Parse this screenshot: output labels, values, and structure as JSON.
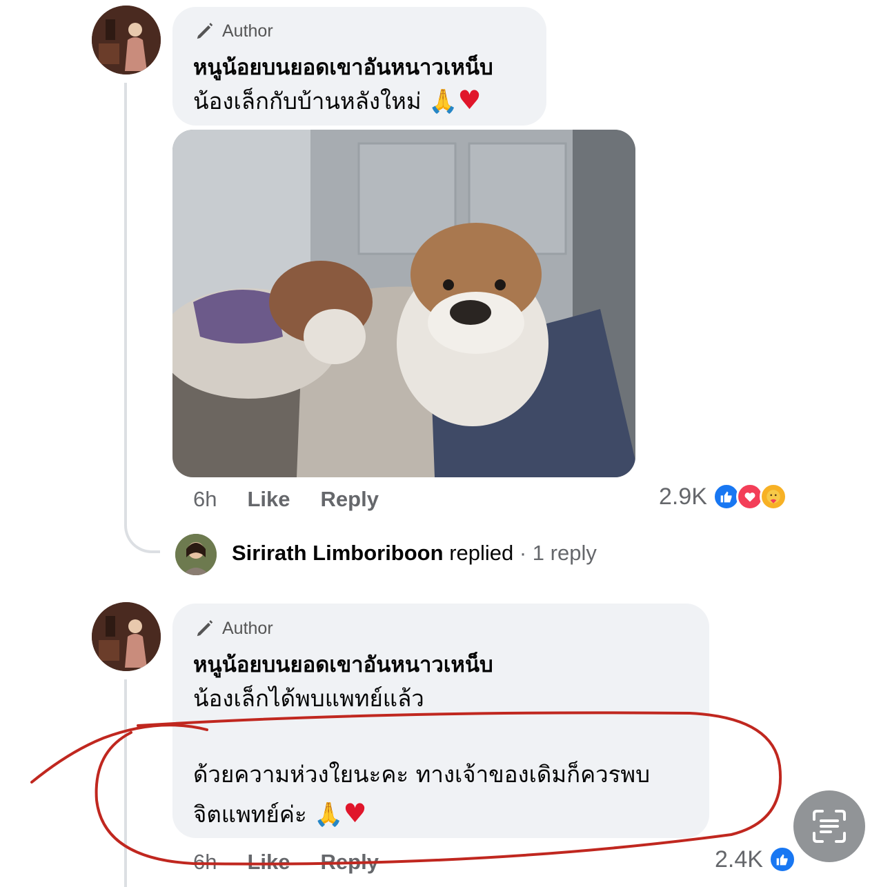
{
  "comments": [
    {
      "badge": "Author",
      "name": "หนูน้อยบนยอดเขาอันหนาวเหน็บ",
      "text_line1": "น้องเล็กกับบ้านหลังใหม่",
      "time": "6h",
      "like": "Like",
      "reply": "Reply",
      "reactions_count": "2.9K",
      "reactions": [
        "like-icon",
        "love-icon",
        "care-icon"
      ]
    },
    {
      "badge": "Author",
      "name": "หนูน้อยบนยอดเขาอันหนาวเหน็บ",
      "text_line1": "น้องเล็กได้พบแพทย์แล้ว",
      "text_line2": "ด้วยความห่วงใยนะคะ ทางเจ้าของเดิมก็ควรพบ",
      "text_line3": "จิตแพทย์ค่ะ",
      "time": "6h",
      "like": "Like",
      "reply": "Reply",
      "reactions_count": "2.4K",
      "reactions": [
        "like-icon"
      ]
    }
  ],
  "replies_summary": {
    "name": "Sirirath Limboriboon",
    "verb": "replied",
    "count": "· 1 reply"
  },
  "emoji": {
    "pray": "🙏",
    "heart": "♥"
  },
  "colors": {
    "bubble": "#f0f2f5",
    "meta_text": "#65676b",
    "like_blue": "#1877f2",
    "love_red": "#f33e58",
    "annotation_red": "#c0271f"
  }
}
